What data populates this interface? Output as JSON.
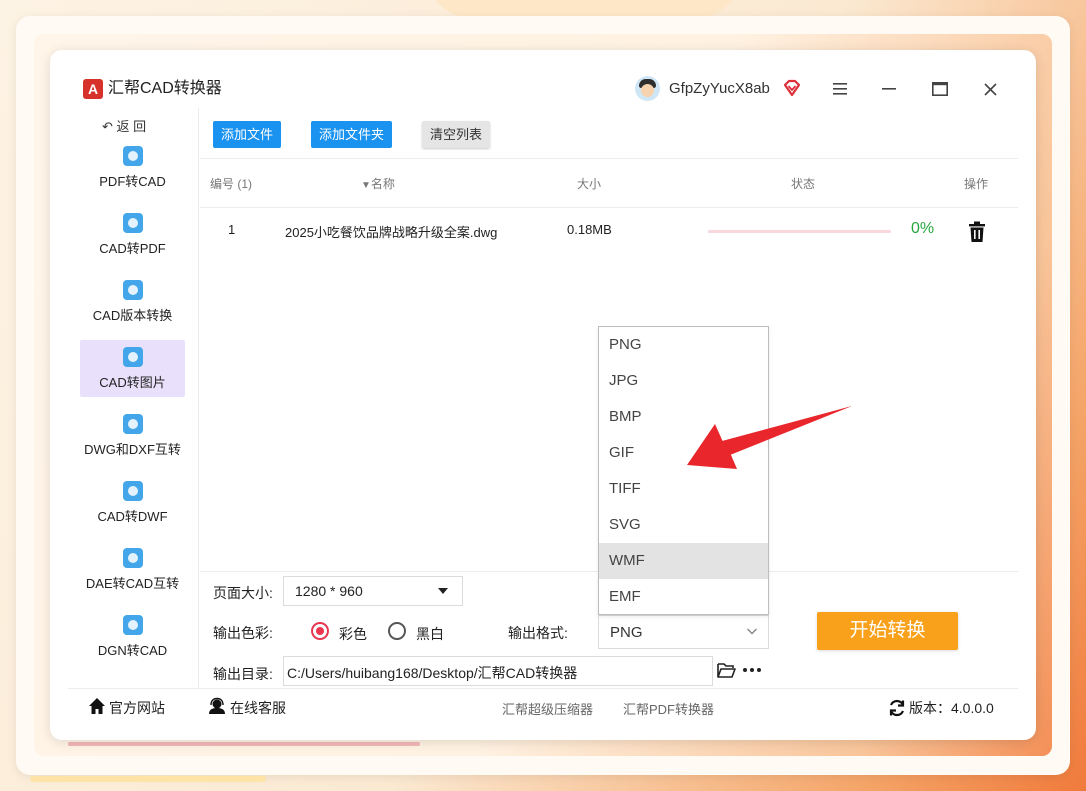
{
  "app": {
    "title": "汇帮CAD转换器",
    "logo_letter": "A",
    "username": "GfpZyYucX8ab"
  },
  "sidebar": {
    "back_label": "返 回",
    "items": [
      {
        "label": "PDF转CAD",
        "active": false
      },
      {
        "label": "CAD转PDF",
        "active": false
      },
      {
        "label": "CAD版本转换",
        "active": false
      },
      {
        "label": "CAD转图片",
        "active": true
      },
      {
        "label": "DWG和DXF互转",
        "active": false
      },
      {
        "label": "CAD转DWF",
        "active": false
      },
      {
        "label": "DAE转CAD互转",
        "active": false
      },
      {
        "label": "DGN转CAD",
        "active": false
      }
    ]
  },
  "toolbar": {
    "add_file": "添加文件",
    "add_folder": "添加文件夹",
    "clear_list": "清空列表"
  },
  "table": {
    "headers": {
      "index": "编号 (1)",
      "name": "名称",
      "size": "大小",
      "status": "状态",
      "action": "操作"
    },
    "rows": [
      {
        "index": "1",
        "name": "2025小吃餐饮品牌战略升级全案.dwg",
        "size": "0.18MB",
        "progress": 0,
        "progress_text": "0%"
      }
    ]
  },
  "settings": {
    "page_size_label": "页面大小:",
    "page_size_value": "1280 * 960",
    "color_label": "输出色彩:",
    "color_options": [
      "彩色",
      "黑白"
    ],
    "color_selected": "彩色",
    "format_label": "输出格式:",
    "format_value": "PNG",
    "format_options": [
      "PNG",
      "JPG",
      "BMP",
      "GIF",
      "TIFF",
      "SVG",
      "WMF",
      "EMF"
    ],
    "format_hovered": "WMF",
    "dir_label": "输出目录:",
    "dir_value": "C:/Users/huibang168/Desktop/汇帮CAD转换器",
    "start_button": "开始转换"
  },
  "footer": {
    "website": "官方网站",
    "support": "在线客服",
    "link1": "汇帮超级压缩器",
    "link2": "汇帮PDF转换器",
    "version": "版本：4.0.0.0"
  },
  "colors": {
    "accent_blue": "#1a93f0",
    "start_orange": "#f9a11b",
    "radio_red": "#e8364f",
    "progress_green": "#27a63f",
    "arrow_red": "#e8262b",
    "active_nav_bg": "#e9e1fb"
  },
  "icons": {
    "titlebar": [
      "app-logo-icon",
      "avatar-icon",
      "vip-diamond-icon",
      "menu-icon",
      "minimize-icon",
      "maximize-icon",
      "close-icon"
    ],
    "row": [
      "trash-icon"
    ],
    "output_dir": [
      "folder-open-icon",
      "more-icon"
    ],
    "footer": [
      "home-icon",
      "headset-icon",
      "refresh-icon"
    ]
  }
}
